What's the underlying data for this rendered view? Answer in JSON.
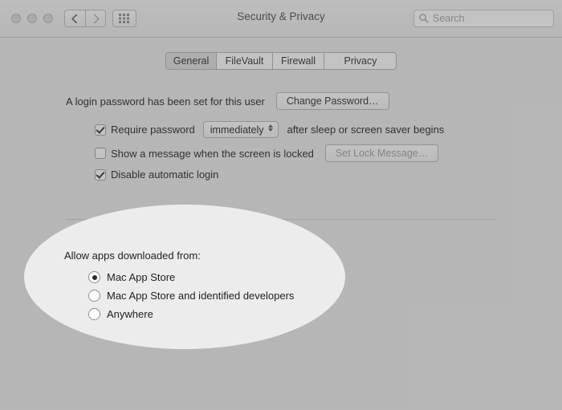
{
  "window": {
    "title": "Security & Privacy",
    "search_placeholder": "Search"
  },
  "tabs": {
    "items": [
      "General",
      "FileVault",
      "Firewall",
      "Privacy"
    ],
    "selected": 0
  },
  "password_section": {
    "set_text": "A login password has been set for this user",
    "change_button": "Change Password…",
    "require_checkbox_label_pre": "Require password",
    "require_select_value": "immediately",
    "require_checkbox_label_post": "after sleep or screen saver begins",
    "require_checked": true,
    "show_message_label": "Show a message when the screen is locked",
    "show_message_checked": false,
    "set_lock_message_button": "Set Lock Message…",
    "disable_auto_login_label": "Disable automatic login",
    "disable_auto_login_checked": true
  },
  "gatekeeper": {
    "title": "Allow apps downloaded from:",
    "options": [
      "Mac App Store",
      "Mac App Store and identified developers",
      "Anywhere"
    ],
    "selected": 0
  }
}
